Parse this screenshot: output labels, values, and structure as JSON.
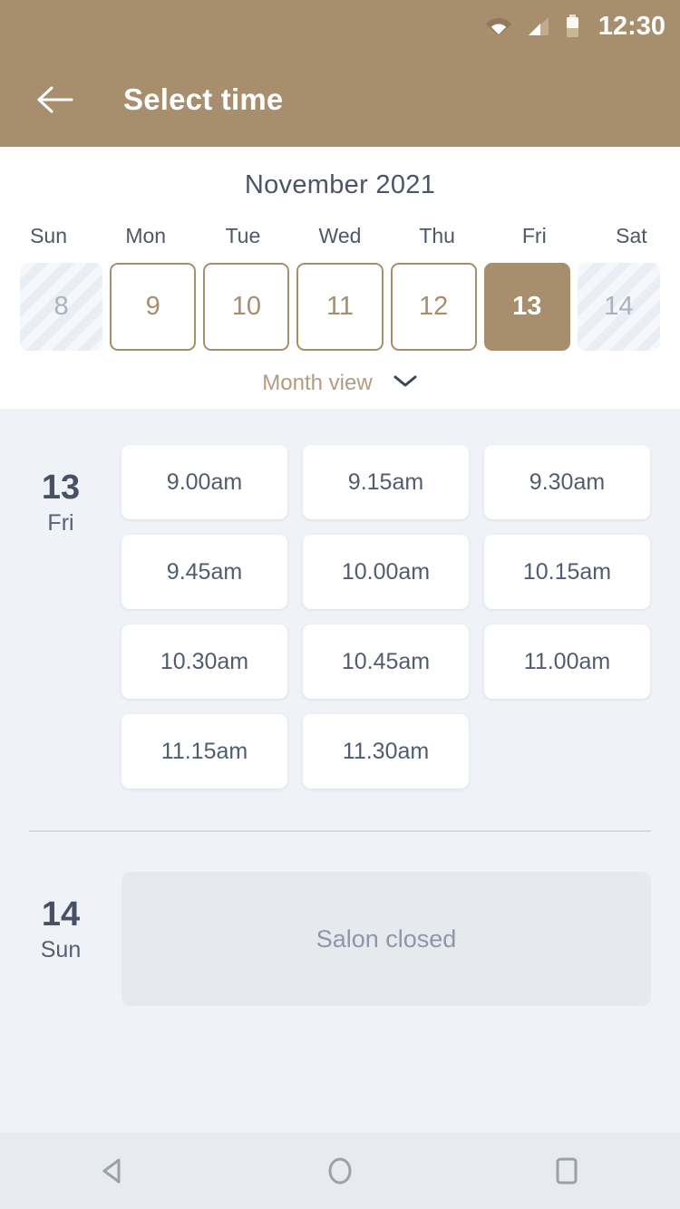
{
  "status_bar": {
    "time": "12:30",
    "icons": [
      "wifi-icon",
      "cellular-signal-icon",
      "battery-icon"
    ]
  },
  "app_bar": {
    "title": "Select time",
    "back_icon": "back-arrow-icon",
    "background_color": "#a78e6c"
  },
  "calendar": {
    "month_label": "November 2021",
    "weekdays": [
      "Sun",
      "Mon",
      "Tue",
      "Wed",
      "Thu",
      "Fri",
      "Sat"
    ],
    "days": [
      {
        "number": "8",
        "state": "disabled"
      },
      {
        "number": "9",
        "state": "available"
      },
      {
        "number": "10",
        "state": "available"
      },
      {
        "number": "11",
        "state": "available"
      },
      {
        "number": "12",
        "state": "available"
      },
      {
        "number": "13",
        "state": "selected"
      },
      {
        "number": "14",
        "state": "disabled"
      }
    ],
    "view_toggle_label": "Month view",
    "view_toggle_icon": "chevron-down-icon",
    "accent_color": "#a78e6c",
    "disabled_color": "#aab2bf"
  },
  "schedule": [
    {
      "day_number": "13",
      "day_of_week": "Fri",
      "slots": [
        "9.00am",
        "9.15am",
        "9.30am",
        "9.45am",
        "10.00am",
        "10.15am",
        "10.30am",
        "10.45am",
        "11.00am",
        "11.15am",
        "11.30am"
      ]
    },
    {
      "day_number": "14",
      "day_of_week": "Sun",
      "slots": [],
      "closed_message": "Salon closed"
    }
  ],
  "nav_bar": {
    "back_icon": "nav-back-triangle-icon",
    "home_icon": "nav-home-circle-icon",
    "recents_icon": "nav-recents-square-icon"
  }
}
